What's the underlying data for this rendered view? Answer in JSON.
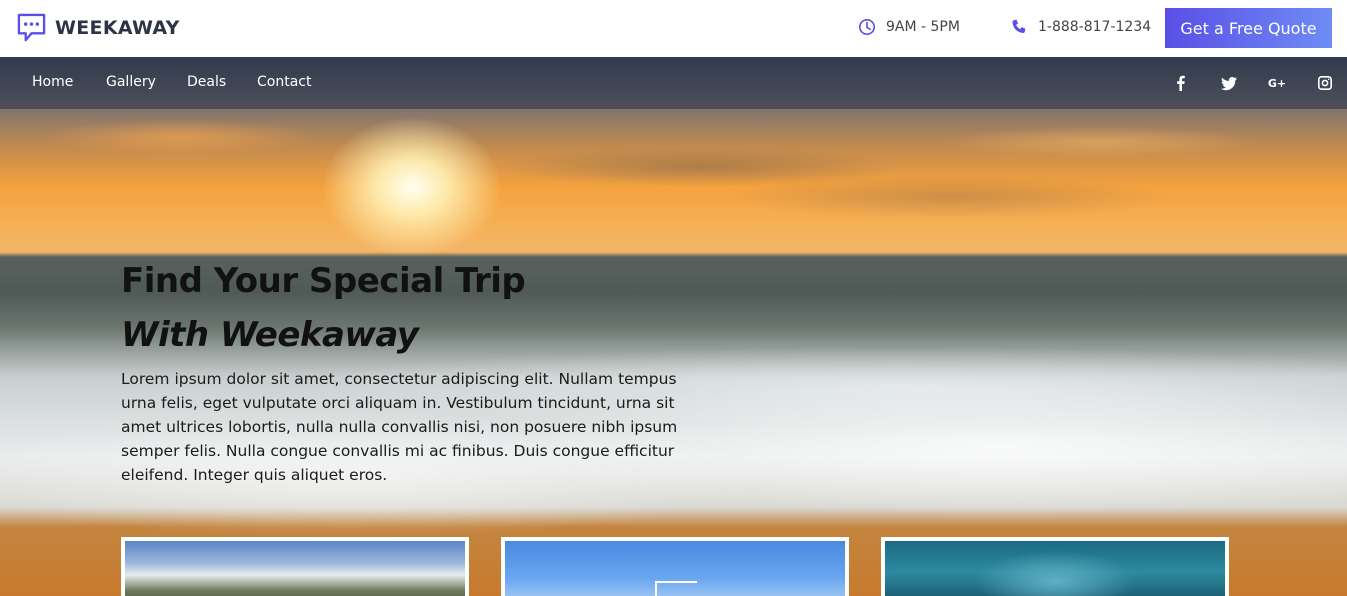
{
  "brand": {
    "name": "WEEKAWAY",
    "accent_color": "#5a4fe6",
    "logo_icon": "chat-bubble-icon"
  },
  "header": {
    "hours": {
      "icon": "clock-icon",
      "text": "9AM - 5PM"
    },
    "phone": {
      "icon": "phone-icon",
      "text": "1-888-817-1234"
    },
    "cta_label": "Get a Free Quote"
  },
  "nav": {
    "items": [
      {
        "label": "Home"
      },
      {
        "label": "Gallery"
      },
      {
        "label": "Deals"
      },
      {
        "label": "Contact"
      }
    ],
    "social": [
      {
        "icon": "facebook-icon"
      },
      {
        "icon": "twitter-icon"
      },
      {
        "icon": "google-plus-icon",
        "text": "G+"
      },
      {
        "icon": "instagram-icon"
      }
    ]
  },
  "hero": {
    "title_line1": "Find Your Special Trip",
    "title_line2": "With Weekaway",
    "body": "Lorem ipsum dolor sit amet, consectetur adipiscing elit. Nullam tempus urna felis, eget vulputate orci aliquam in. Vestibulum tincidunt, urna sit amet ultrices lobortis, nulla nulla convallis nisi, non posuere nibh ipsum semper felis. Nulla congue convallis mi ac finibus. Duis congue efficitur eleifend. Integer quis aliquet eros."
  },
  "cards": [
    {
      "image": "coast-landscape-photo"
    },
    {
      "image": "boat-sky-photo"
    },
    {
      "image": "snorkeling-photo"
    }
  ]
}
